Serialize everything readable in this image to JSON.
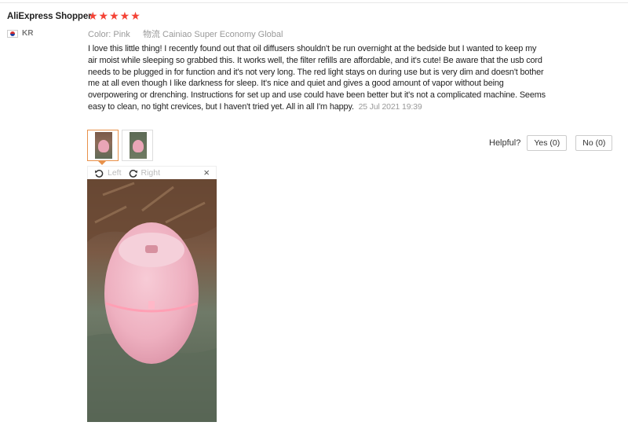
{
  "review": {
    "reviewer": "AliExpress Shopper",
    "stars": "★★★★★",
    "rating": 5,
    "country_code": "KR",
    "color_label": "Color:",
    "color_value": "Pink",
    "shipping_label": "物流",
    "shipping_value": "Cainiao Super Economy Global",
    "text": "I love this little thing! I recently found out that oil diffusers shouldn't be run overnight at the bedside but I wanted to keep my air moist while sleeping so grabbed this. It works well, the filter refills are affordable, and it's cute! Be aware that the usb cord needs to be plugged in for function and it's not very long. The red light stays on during use but is very dim and doesn't bother me at all even though I like darkness for sleep. It's nice and quiet and gives a good amount of vapor without being overpowering or drenching. Instructions for set up and use could have been better but it's not a complicated machine. Seems easy to clean, no tight crevices, but I haven't tried yet. All in all I'm happy.",
    "date": "25 Jul 2021 19:39"
  },
  "image_viewer": {
    "rotate_left": "Left",
    "rotate_right": "Right",
    "close": "×"
  },
  "helpful": {
    "label": "Helpful?",
    "yes": "Yes (0)",
    "no": "No (0)"
  },
  "colors": {
    "star": "#f44336",
    "active_thumb": "#e8914a",
    "muted": "#999999"
  },
  "icons": {
    "rotate_left": "rotate-left-icon",
    "rotate_right": "rotate-right-icon",
    "close": "close-icon",
    "flag": "korea-flag-icon"
  }
}
